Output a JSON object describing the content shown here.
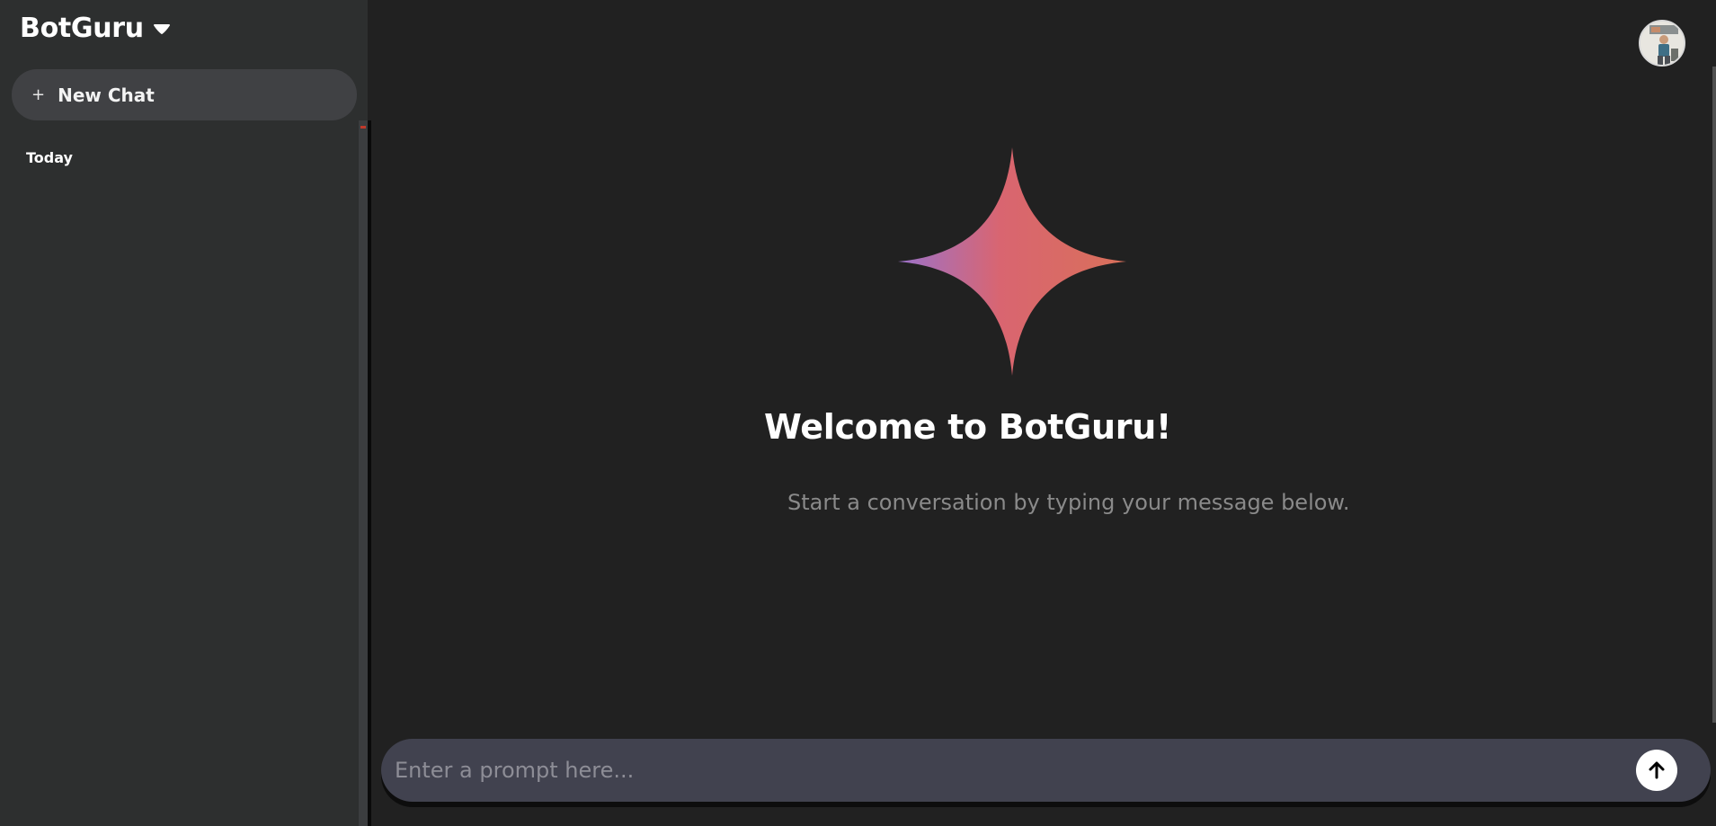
{
  "sidebar": {
    "brand": "BotGuru",
    "new_chat_label": "New Chat",
    "new_chat_icon": "+",
    "sections": [
      {
        "title": "Today"
      }
    ]
  },
  "main": {
    "welcome_title": "Welcome to BotGuru!",
    "welcome_subtitle": "Start a conversation by typing your message below.",
    "prompt_placeholder": "Enter a prompt here...",
    "prompt_value": ""
  },
  "icons": {
    "brand_caret": "caret-down-icon",
    "spark": "sparkle-icon",
    "send": "arrow-up-icon",
    "avatar": "user-avatar"
  },
  "colors": {
    "background": "#212121",
    "sidebar": "#2d2f2f",
    "new_chat_bg": "#404144",
    "prompt_bg": "#41424f",
    "spark_gradient": [
      "#9b72cb",
      "#d96570",
      "#d9705a"
    ]
  }
}
